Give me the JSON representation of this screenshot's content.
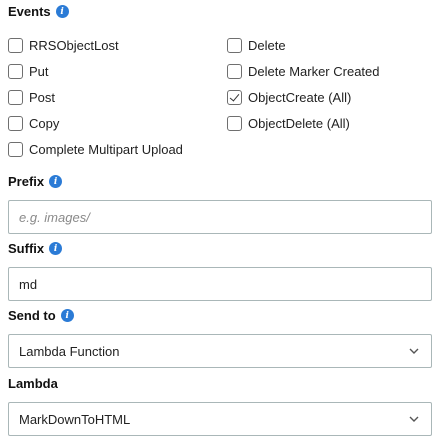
{
  "events": {
    "title": "Events",
    "left_column": [
      {
        "label": "RRSObjectLost",
        "checked": false
      },
      {
        "label": "Put",
        "checked": false
      },
      {
        "label": "Post",
        "checked": false
      },
      {
        "label": "Copy",
        "checked": false
      },
      {
        "label": "Complete Multipart Upload",
        "checked": false
      }
    ],
    "right_column": [
      {
        "label": "Delete",
        "checked": false
      },
      {
        "label": "Delete Marker Created",
        "checked": false
      },
      {
        "label": "ObjectCreate (All)",
        "checked": true
      },
      {
        "label": "ObjectDelete (All)",
        "checked": false
      }
    ]
  },
  "prefix": {
    "label": "Prefix",
    "value": "",
    "placeholder": "e.g. images/"
  },
  "suffix": {
    "label": "Suffix",
    "value": "md",
    "placeholder": ""
  },
  "send_to": {
    "label": "Send to",
    "selected": "Lambda Function"
  },
  "lambda": {
    "label": "Lambda",
    "selected": "MarkDownToHTML"
  },
  "icons": {
    "info": "info-icon",
    "chevron": "chevron-down-icon"
  },
  "colors": {
    "info_icon": "#2b7bd6",
    "field_border": "#aab7b8"
  }
}
